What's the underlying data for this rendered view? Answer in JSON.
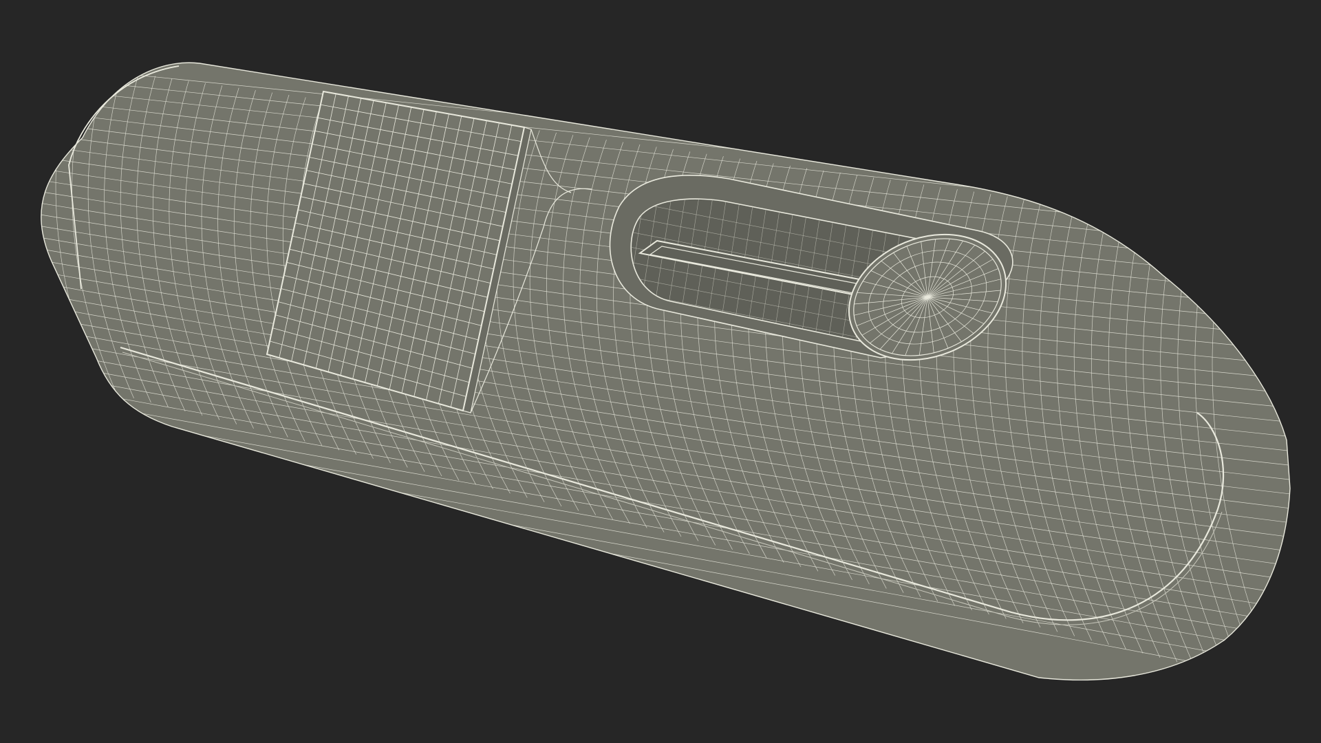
{
  "scene": {
    "background_color": "#262626",
    "subject": "wireframe-3d-model",
    "colors": {
      "surface": "#74756b",
      "surface_dark": "#6a6b62",
      "recess": "#5f6058",
      "wire": "#e9e9dd",
      "wire_faint": "#c9c9bd"
    }
  }
}
